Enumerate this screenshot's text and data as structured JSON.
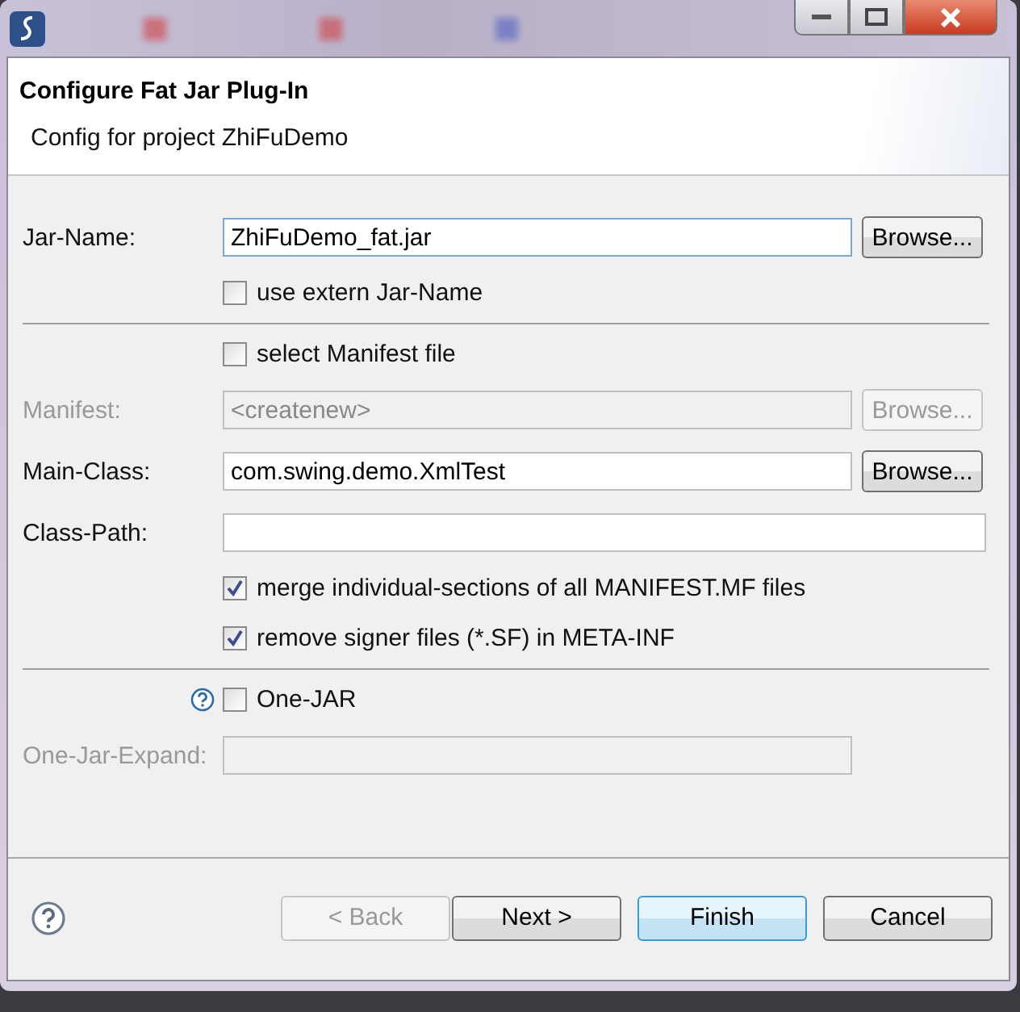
{
  "header": {
    "title": "Configure Fat Jar Plug-In",
    "subtitle": "Config for project ZhiFuDemo"
  },
  "rows": [
    {
      "kind": "field",
      "label": "Jar-Name:",
      "value": "ZhiFuDemo_fat.jar",
      "disabled": false,
      "focused": true,
      "browse": {
        "label": "Browse...",
        "disabled": false
      }
    },
    {
      "kind": "checkbox",
      "label": "use extern Jar-Name",
      "checked": false
    },
    {
      "kind": "separator"
    },
    {
      "kind": "checkbox",
      "label": "select Manifest file",
      "checked": false
    },
    {
      "kind": "field",
      "label": "Manifest:",
      "value": "<createnew>",
      "disabled": true,
      "focused": false,
      "browse": {
        "label": "Browse...",
        "disabled": true
      }
    },
    {
      "kind": "field",
      "label": "Main-Class:",
      "value": "com.swing.demo.XmlTest",
      "disabled": false,
      "focused": false,
      "browse": {
        "label": "Browse...",
        "disabled": false
      }
    },
    {
      "kind": "field",
      "label": "Class-Path:",
      "disabled": false,
      "focused": false
    },
    {
      "kind": "checkbox",
      "label": "merge individual-sections of all MANIFEST.MF files",
      "checked": true
    },
    {
      "kind": "checkbox",
      "label": "remove signer files (*.SF) in META-INF",
      "checked": true
    },
    {
      "kind": "separator"
    },
    {
      "kind": "checkbox",
      "label": "One-JAR",
      "checked": false,
      "help": true
    },
    {
      "kind": "field",
      "label": "One-Jar-Expand:",
      "disabled": true,
      "focused": false
    }
  ],
  "buttons": [
    {
      "label": "< Back",
      "disabled": true,
      "default": false
    },
    {
      "label": "Next >",
      "disabled": false,
      "default": false
    },
    {
      "label": "Finish",
      "disabled": false,
      "default": true
    },
    {
      "label": "Cancel",
      "disabled": false,
      "default": false
    }
  ]
}
